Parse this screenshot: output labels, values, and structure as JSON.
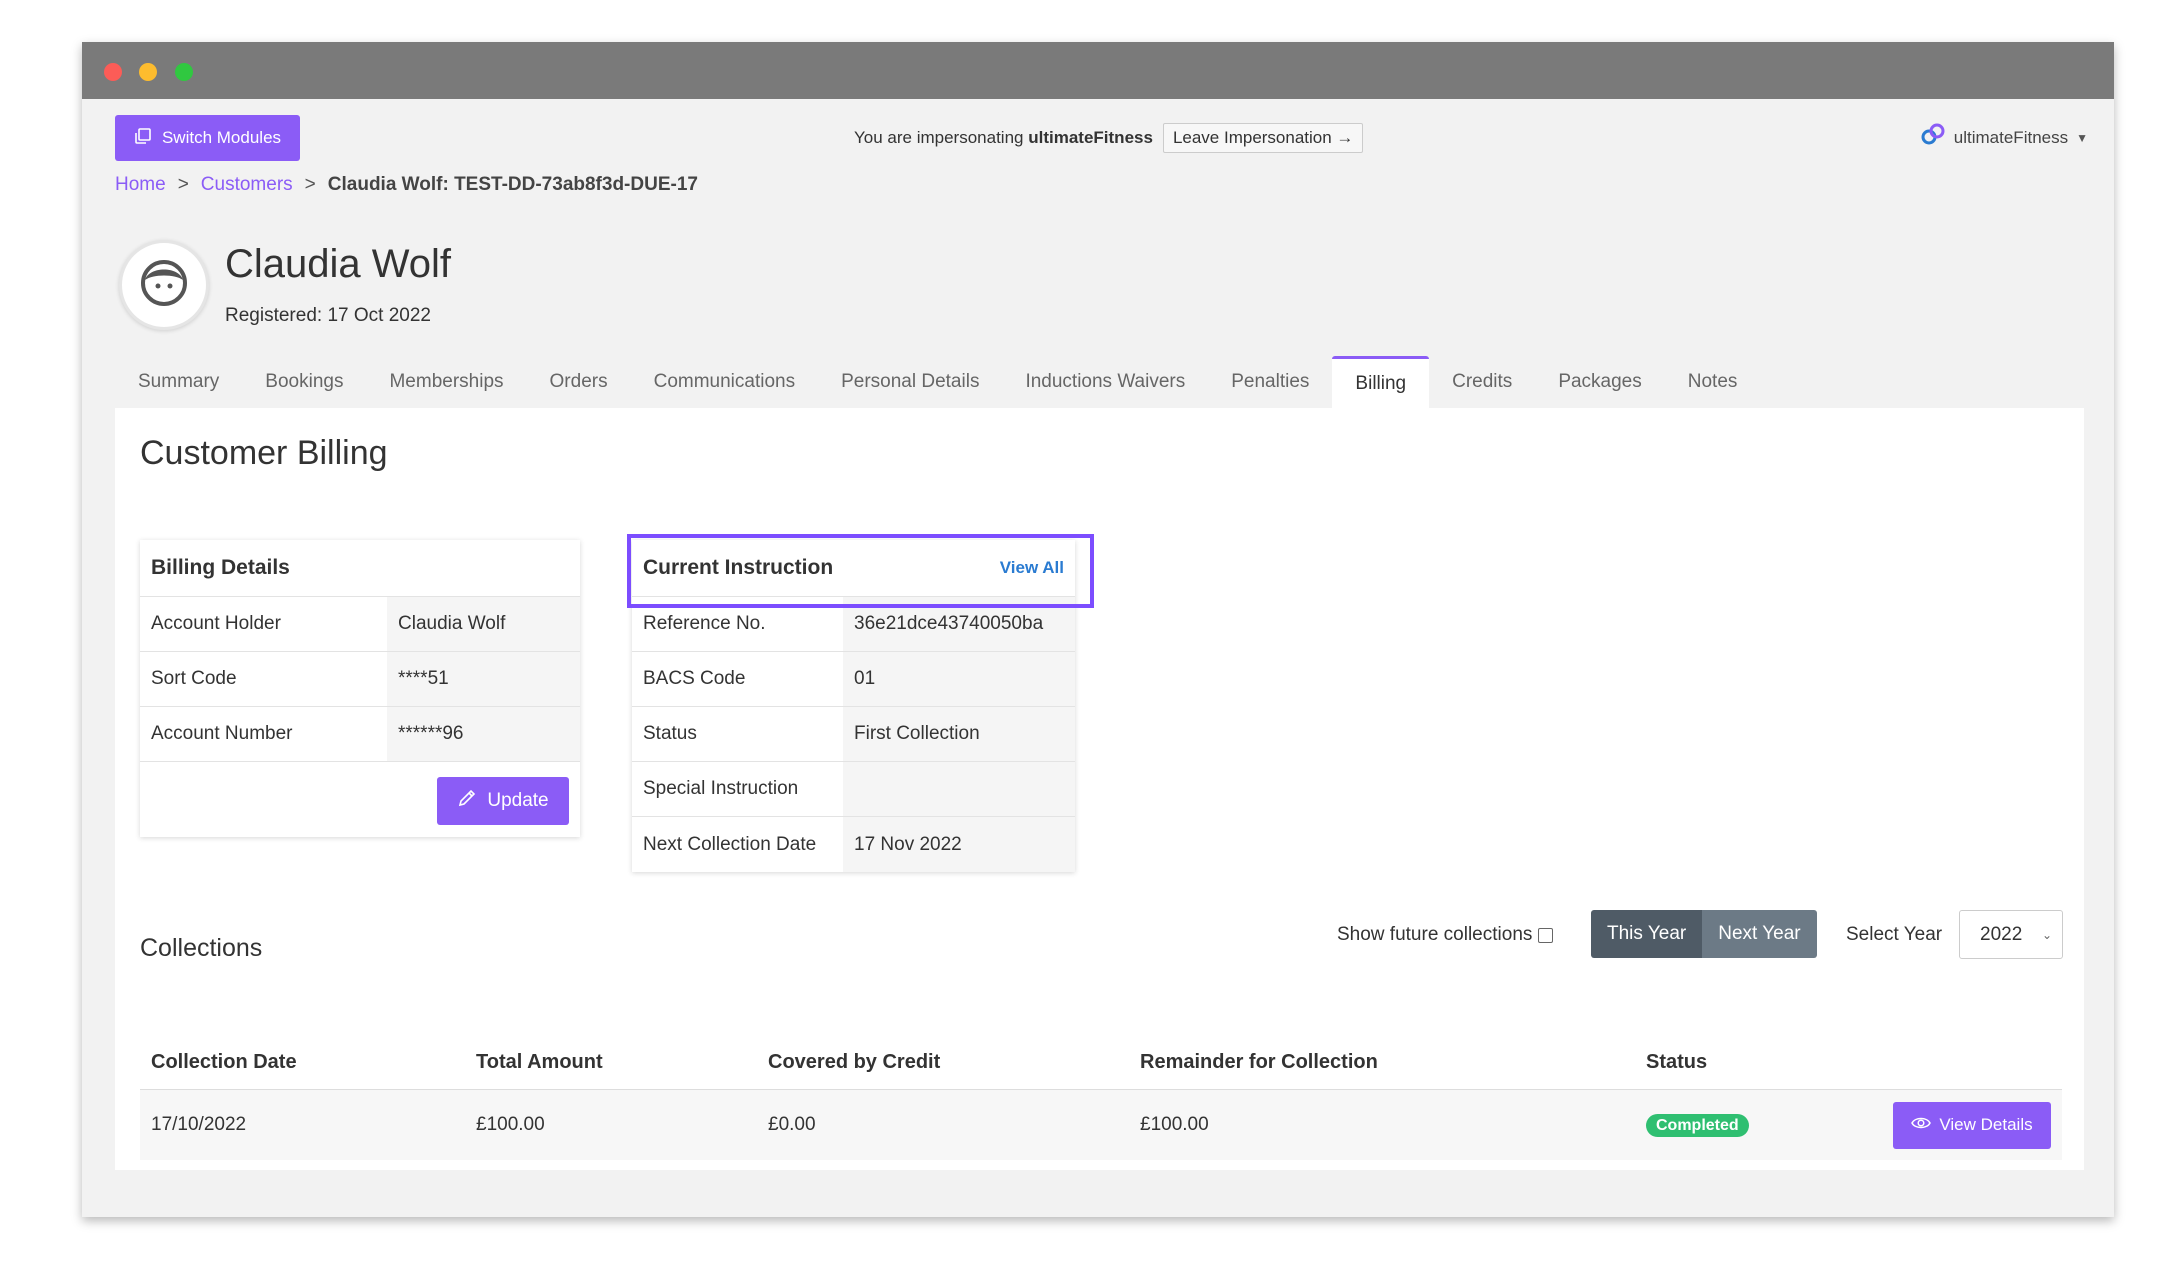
{
  "topbar": {
    "switch_modules": "Switch Modules",
    "impersonating_text": "You are impersonating",
    "impersonated_account": "ultimateFitness",
    "leave_impersonation": "Leave Impersonation →",
    "account_name": "ultimateFitness"
  },
  "breadcrumb": {
    "home": "Home",
    "customers": "Customers",
    "separator": ">",
    "current": "Claudia Wolf: TEST-DD-73ab8f3d-DUE-17"
  },
  "customer": {
    "name": "Claudia Wolf",
    "registered": "Registered: 17 Oct 2022"
  },
  "tabs": [
    {
      "label": "Summary"
    },
    {
      "label": "Bookings"
    },
    {
      "label": "Memberships"
    },
    {
      "label": "Orders"
    },
    {
      "label": "Communications"
    },
    {
      "label": "Personal Details"
    },
    {
      "label": "Inductions Waivers"
    },
    {
      "label": "Penalties"
    },
    {
      "label": "Billing"
    },
    {
      "label": "Credits"
    },
    {
      "label": "Packages"
    },
    {
      "label": "Notes"
    }
  ],
  "active_tab": "Billing",
  "billing": {
    "title": "Customer Billing",
    "details": {
      "heading": "Billing Details",
      "rows": [
        {
          "label": "Account Holder",
          "value": "Claudia Wolf"
        },
        {
          "label": "Sort Code",
          "value": "****51"
        },
        {
          "label": "Account Number",
          "value": "******96"
        }
      ],
      "update_label": "Update"
    },
    "instruction": {
      "heading": "Current Instruction",
      "view_all": "View All",
      "rows": [
        {
          "label": "Reference No.",
          "value": "36e21dce43740050ba"
        },
        {
          "label": "BACS Code",
          "value": "01"
        },
        {
          "label": "Status",
          "value": "First Collection"
        },
        {
          "label": "Special Instruction",
          "value": ""
        },
        {
          "label": "Next Collection Date",
          "value": "17 Nov 2022"
        }
      ]
    }
  },
  "collections": {
    "title": "Collections",
    "show_future_label": "Show future collections",
    "show_future_checked": false,
    "this_year": "This Year",
    "next_year": "Next Year",
    "select_year_label": "Select Year",
    "selected_year": "2022",
    "columns": [
      "Collection Date",
      "Total Amount",
      "Covered by Credit",
      "Remainder for Collection",
      "Status"
    ],
    "rows": [
      {
        "date": "17/10/2022",
        "total": "£100.00",
        "credit": "£0.00",
        "remainder": "£100.00",
        "status": "Completed",
        "action": "View Details"
      }
    ]
  },
  "colors": {
    "accent": "#8b5cf6",
    "link": "#2a7bd1",
    "success": "#2fbf71",
    "highlight_border": "#7c4dff"
  }
}
